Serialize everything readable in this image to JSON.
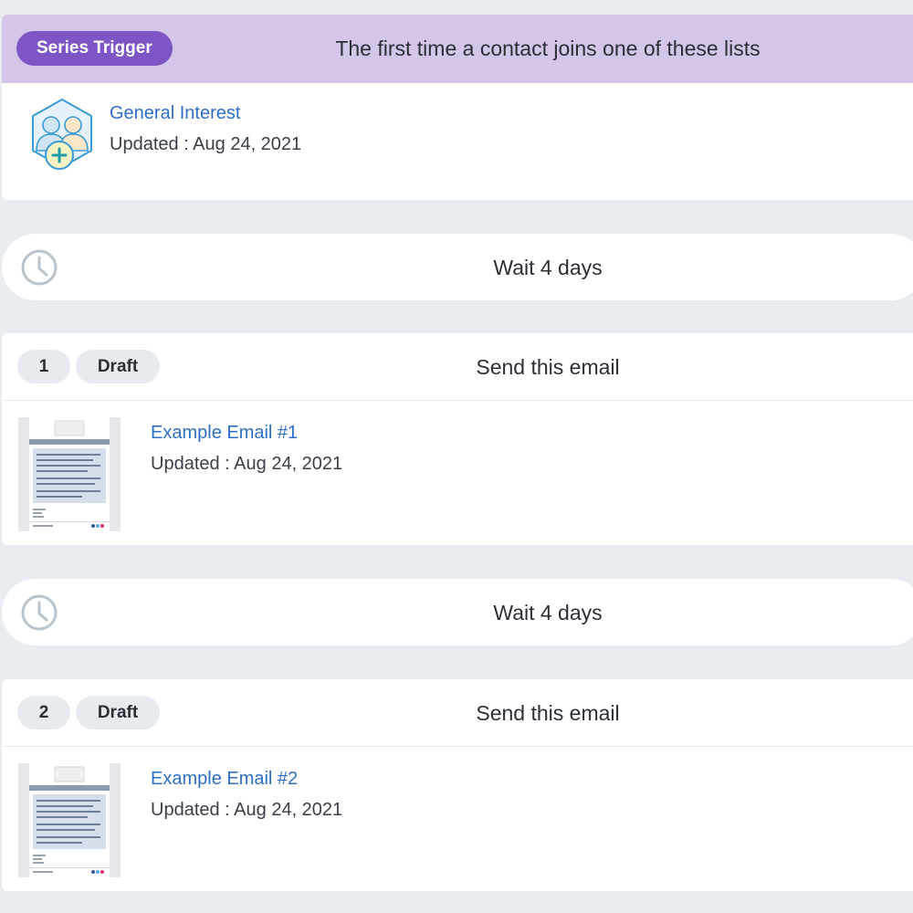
{
  "trigger": {
    "badge": "Series Trigger",
    "title": "The first time a contact joins one of these lists",
    "list": {
      "name": "General Interest",
      "updated": "Updated : Aug 24, 2021",
      "icon": "contact-list-add-icon"
    }
  },
  "steps": [
    {
      "type": "wait",
      "label": "Wait 4 days",
      "icon": "clock-icon"
    },
    {
      "type": "email",
      "number": "1",
      "status": "Draft",
      "title": "Send this email",
      "email": {
        "name": "Example Email #1",
        "updated": "Updated : Aug 24, 2021"
      }
    },
    {
      "type": "wait",
      "label": "Wait 4 days",
      "icon": "clock-icon"
    },
    {
      "type": "email",
      "number": "2",
      "status": "Draft",
      "title": "Send this email",
      "email": {
        "name": "Example Email #2",
        "updated": "Updated : Aug 24, 2021"
      }
    }
  ],
  "colors": {
    "accent": "#7d55c4",
    "trigger_header": "#d3c6e8",
    "link": "#2e6fc5",
    "background": "#e9edf1"
  }
}
